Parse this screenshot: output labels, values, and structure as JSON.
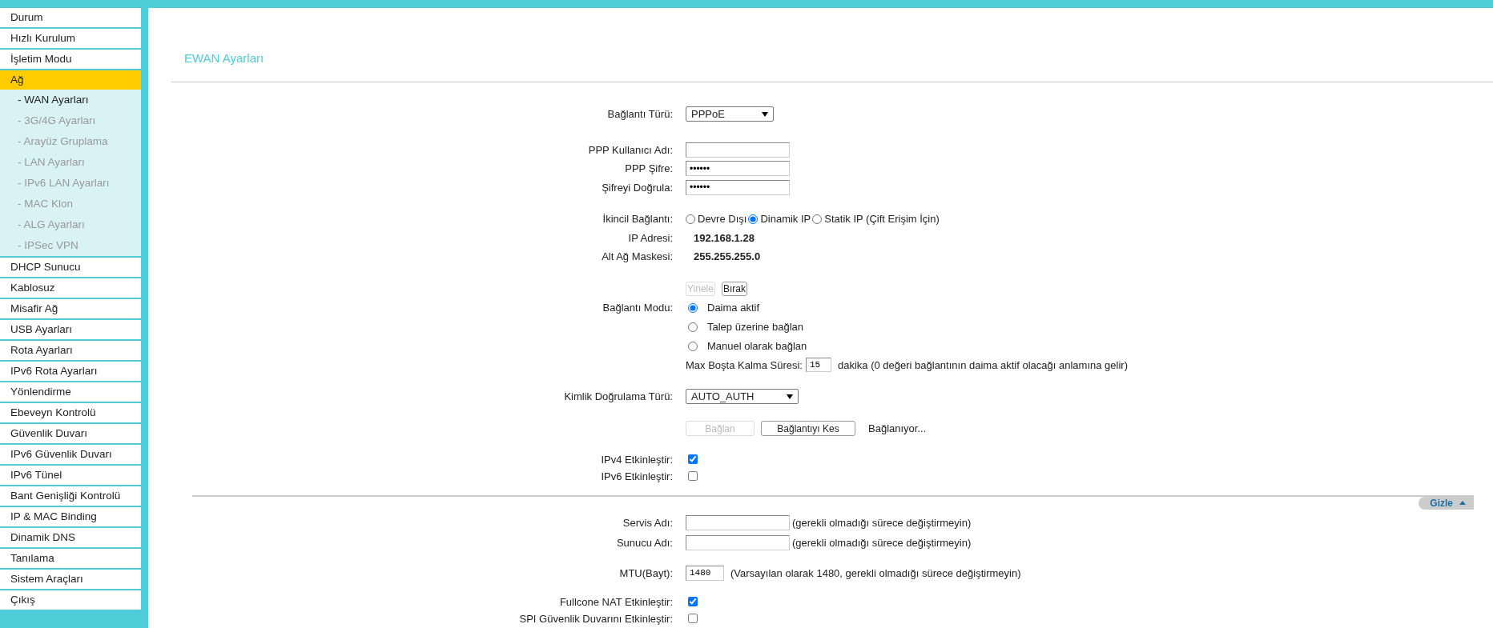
{
  "sidebar": {
    "items": [
      {
        "label": "Durum",
        "selected": false
      },
      {
        "label": "Hızlı Kurulum",
        "selected": false
      },
      {
        "label": "İşletim Modu",
        "selected": false
      },
      {
        "label": "Ağ",
        "selected": true,
        "children": [
          {
            "label": "- WAN Ayarları",
            "selected": true
          },
          {
            "label": "- 3G/4G Ayarları",
            "selected": false
          },
          {
            "label": "- Arayüz Gruplama",
            "selected": false
          },
          {
            "label": "- LAN Ayarları",
            "selected": false
          },
          {
            "label": "- IPv6 LAN Ayarları",
            "selected": false
          },
          {
            "label": "- MAC Klon",
            "selected": false
          },
          {
            "label": "- ALG Ayarları",
            "selected": false
          },
          {
            "label": "- IPSec VPN",
            "selected": false
          }
        ]
      },
      {
        "label": "DHCP Sunucu",
        "selected": false
      },
      {
        "label": "Kablosuz",
        "selected": false
      },
      {
        "label": "Misafir Ağ",
        "selected": false
      },
      {
        "label": "USB Ayarları",
        "selected": false
      },
      {
        "label": "Rota Ayarları",
        "selected": false
      },
      {
        "label": "IPv6 Rota Ayarları",
        "selected": false
      },
      {
        "label": "Yönlendirme",
        "selected": false
      },
      {
        "label": "Ebeveyn Kontrolü",
        "selected": false
      },
      {
        "label": "Güvenlik Duvarı",
        "selected": false
      },
      {
        "label": "IPv6 Güvenlik Duvarı",
        "selected": false
      },
      {
        "label": "IPv6 Tünel",
        "selected": false
      },
      {
        "label": "Bant Genişliği Kontrolü",
        "selected": false
      },
      {
        "label": "IP & MAC Binding",
        "selected": false
      },
      {
        "label": "Dinamik DNS",
        "selected": false
      },
      {
        "label": "Tanılama",
        "selected": false
      },
      {
        "label": "Sistem Araçları",
        "selected": false
      },
      {
        "label": "Çıkış",
        "selected": false
      }
    ]
  },
  "page": {
    "title": "EWAN Ayarları"
  },
  "form": {
    "sections": [
      {
        "rows": [
          {
            "kind": "select",
            "label": "Bağlantı Türü:",
            "value": "PPPoE"
          }
        ]
      },
      {
        "rows": [
          {
            "kind": "text",
            "label": "PPP Kullanıcı Adı:"
          },
          {
            "kind": "text",
            "label": "PPP Şifre:",
            "value": "••••••"
          },
          {
            "kind": "text",
            "label": "Şifreyi Doğrula:",
            "value": "••••••"
          }
        ]
      },
      {
        "rows": [
          {
            "kind": "radio",
            "label": "İkincil Bağlantı:",
            "options": [
              {
                "label": "Devre Dışı",
                "selected": false
              },
              {
                "label": "Dinamik IP",
                "selected": true
              },
              {
                "label": "Statik IP (Çift Erişim İçin)",
                "selected": false
              }
            ]
          },
          {
            "kind": "info",
            "label": "IP Adresi:",
            "value": "192.168.1.28"
          },
          {
            "kind": "info",
            "label": "Alt Ağ Maskesi:",
            "value": "255.255.255.0"
          }
        ]
      },
      {
        "rows": [
          {
            "kind": "buttons",
            "buttons": [
              {
                "label": "Yinele",
                "disabled": true
              },
              {
                "label": "Bırak",
                "disabled": false
              }
            ]
          },
          {
            "kind": "radio-stack",
            "label": "Bağlantı Modu:",
            "options": [
              {
                "label": "Daima aktif",
                "selected": true
              },
              {
                "label": "Talep üzerine bağlan",
                "selected": false
              },
              {
                "label": "Manuel olarak bağlan",
                "selected": false
              }
            ]
          },
          {
            "kind": "inline-number",
            "text": "Max Boşta Kalma Süresi:",
            "value": "15",
            "hint": "dakika (0 değeri bağlantının daima aktif olacağı anlamına gelir)"
          }
        ]
      },
      {
        "rows": [
          {
            "kind": "select",
            "label": "Kimlik Doğrulama Türü:",
            "value": "AUTO_AUTH"
          }
        ]
      },
      {
        "rows": [
          {
            "kind": "buttons",
            "buttons": [
              {
                "label": "Bağlan",
                "disabled": true
              },
              {
                "label": "Bağlantıyı Kes",
                "disabled": false
              }
            ],
            "status": "Bağlanıyor..."
          }
        ]
      },
      {
        "rows": [
          {
            "kind": "checkbox",
            "label": "IPv4 Etkinleştir:",
            "checked": true
          },
          {
            "kind": "checkbox",
            "label": "IPv6 Etkinleştir:",
            "checked": false
          }
        ]
      }
    ],
    "advanced_toggle": {
      "label": "Gizle",
      "expanded": true
    },
    "advanced_sections": [
      {
        "rows": [
          {
            "kind": "text",
            "label": "Servis Adı:",
            "hint": "(gerekli olmadığı sürece değiştirmeyin)"
          },
          {
            "kind": "text",
            "label": "Sunucu Adı:",
            "hint": "(gerekli olmadığı sürece değiştirmeyin)"
          }
        ]
      },
      {
        "rows": [
          {
            "kind": "number",
            "label": "MTU(Bayt):",
            "value": "1480",
            "hint": "(Varsayılan olarak 1480, gerekli olmadığı sürece değiştirmeyin)"
          }
        ]
      },
      {
        "rows": [
          {
            "kind": "checkbox",
            "label": "Fullcone NAT Etkinleştir:",
            "checked": true
          },
          {
            "kind": "checkbox",
            "label": "SPI Güvenlik Duvarını Etkinleştir:",
            "checked": false
          }
        ]
      }
    ]
  }
}
